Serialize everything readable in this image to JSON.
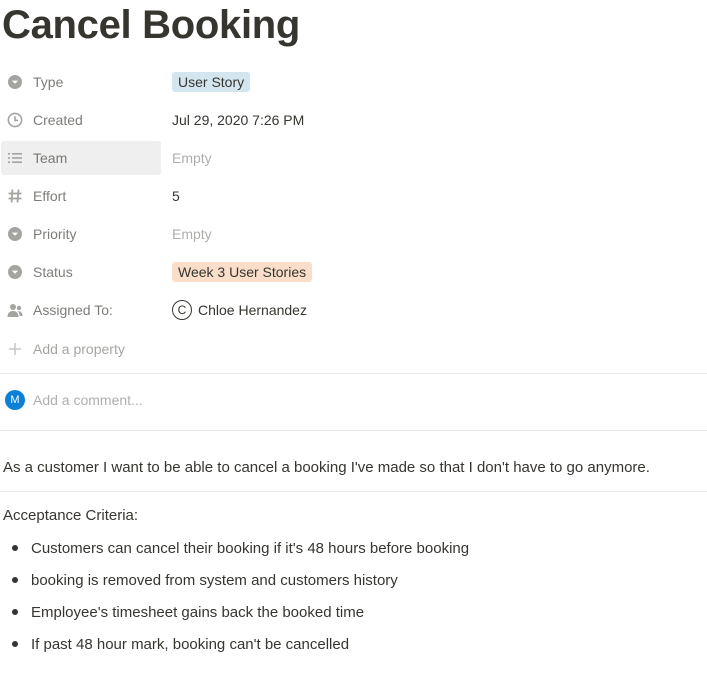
{
  "title": "Cancel Booking",
  "properties": [
    {
      "name": "Type",
      "icon": "select-icon",
      "value": "User Story",
      "kind": "tag",
      "tag_color": "#d3e5ef"
    },
    {
      "name": "Created",
      "icon": "clock-icon",
      "value": "Jul 29, 2020 7:26 PM",
      "kind": "text"
    },
    {
      "name": "Team",
      "icon": "list-icon",
      "value": "Empty",
      "kind": "empty"
    },
    {
      "name": "Effort",
      "icon": "hash-icon",
      "value": "5",
      "kind": "text"
    },
    {
      "name": "Priority",
      "icon": "select-icon",
      "value": "Empty",
      "kind": "empty"
    },
    {
      "name": "Status",
      "icon": "select-icon",
      "value": "Week 3 User Stories",
      "kind": "tag",
      "tag_color": "#fadec9"
    },
    {
      "name": "Assigned To:",
      "icon": "person-icon",
      "value": "Chloe Hernandez",
      "kind": "person",
      "initial": "C"
    }
  ],
  "add_property_label": "Add a property",
  "comment": {
    "avatar_initial": "M",
    "avatar_color": "#0b80d4",
    "placeholder": "Add a comment..."
  },
  "description": "As a customer I want to be able to cancel a booking I've made so that I don't have to go anymore.",
  "criteria_heading": "Acceptance Criteria:",
  "criteria": [
    "Customers can cancel their booking if it's 48 hours before booking",
    "booking is removed from system and customers history",
    "Employee's timesheet gains back the booked time",
    "If past 48 hour mark, booking can't be cancelled"
  ]
}
